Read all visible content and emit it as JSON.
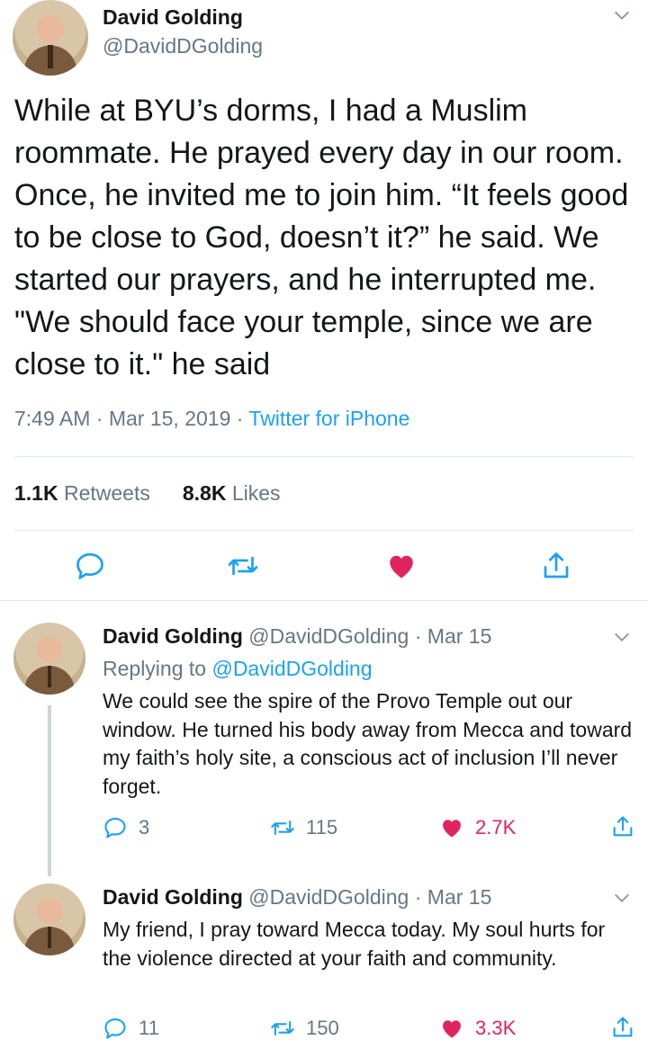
{
  "main_tweet": {
    "author_name": "David Golding",
    "author_handle": "@DavidDGolding",
    "text": "While at BYU’s dorms, I had a Muslim roommate. He prayed every day in our room. Once, he invited me to join him. “It feels good to be close to God, doesn’t it?” he said. We started our prayers, and he interrupted me. \"We should face your temple, since we are close to it.\" he said",
    "time": "7:49 AM",
    "date": "Mar 15, 2019",
    "sep": "·",
    "source": "Twitter for iPhone",
    "retweets_count": "1.1K",
    "retweets_label": "Retweets",
    "likes_count": "8.8K",
    "likes_label": "Likes"
  },
  "replies": [
    {
      "author_name": "David Golding",
      "author_handle": "@DavidDGolding",
      "date": "Mar 15",
      "replying_prefix": "Replying to",
      "replying_to": "@DavidDGolding",
      "text": "We could see the spire of the Provo Temple out our window. He turned his body away from Mecca and toward my faith’s holy site, a conscious act of inclusion I’ll never forget.",
      "reply_count": "3",
      "retweet_count": "115",
      "like_count": "2.7K"
    },
    {
      "author_name": "David Golding",
      "author_handle": "@DavidDGolding",
      "date": "Mar 15",
      "text": "My friend, I pray toward Mecca today. My soul hurts for the violence directed at your faith and community.",
      "reply_count": "11",
      "retweet_count": "150",
      "like_count": "3.3K"
    }
  ],
  "colors": {
    "accent": "#1da1f2",
    "like": "#e0245e",
    "muted": "#657786",
    "text": "#14171a",
    "divider": "#e1e8ed"
  },
  "icons": {
    "reply": "reply-icon",
    "retweet": "retweet-icon",
    "like": "heart-icon",
    "share": "share-icon",
    "more": "chevron-down-icon"
  }
}
